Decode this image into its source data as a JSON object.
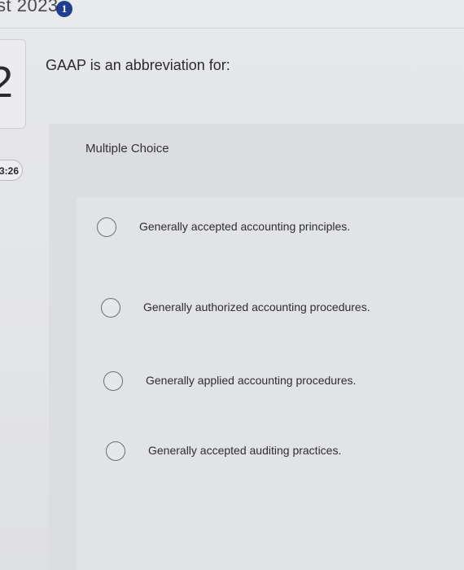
{
  "header": {
    "title": "st 2023",
    "badge": "1"
  },
  "sidebar": {
    "question_number": "2",
    "timer": "3:26"
  },
  "question": {
    "text": "GAAP is an abbreviation for:",
    "type_label": "Multiple Choice",
    "options": [
      {
        "label": "Generally accepted accounting principles."
      },
      {
        "label": "Generally authorized accounting procedures."
      },
      {
        "label": "Generally applied accounting procedures."
      },
      {
        "label": "Generally accepted auditing practices."
      }
    ]
  }
}
